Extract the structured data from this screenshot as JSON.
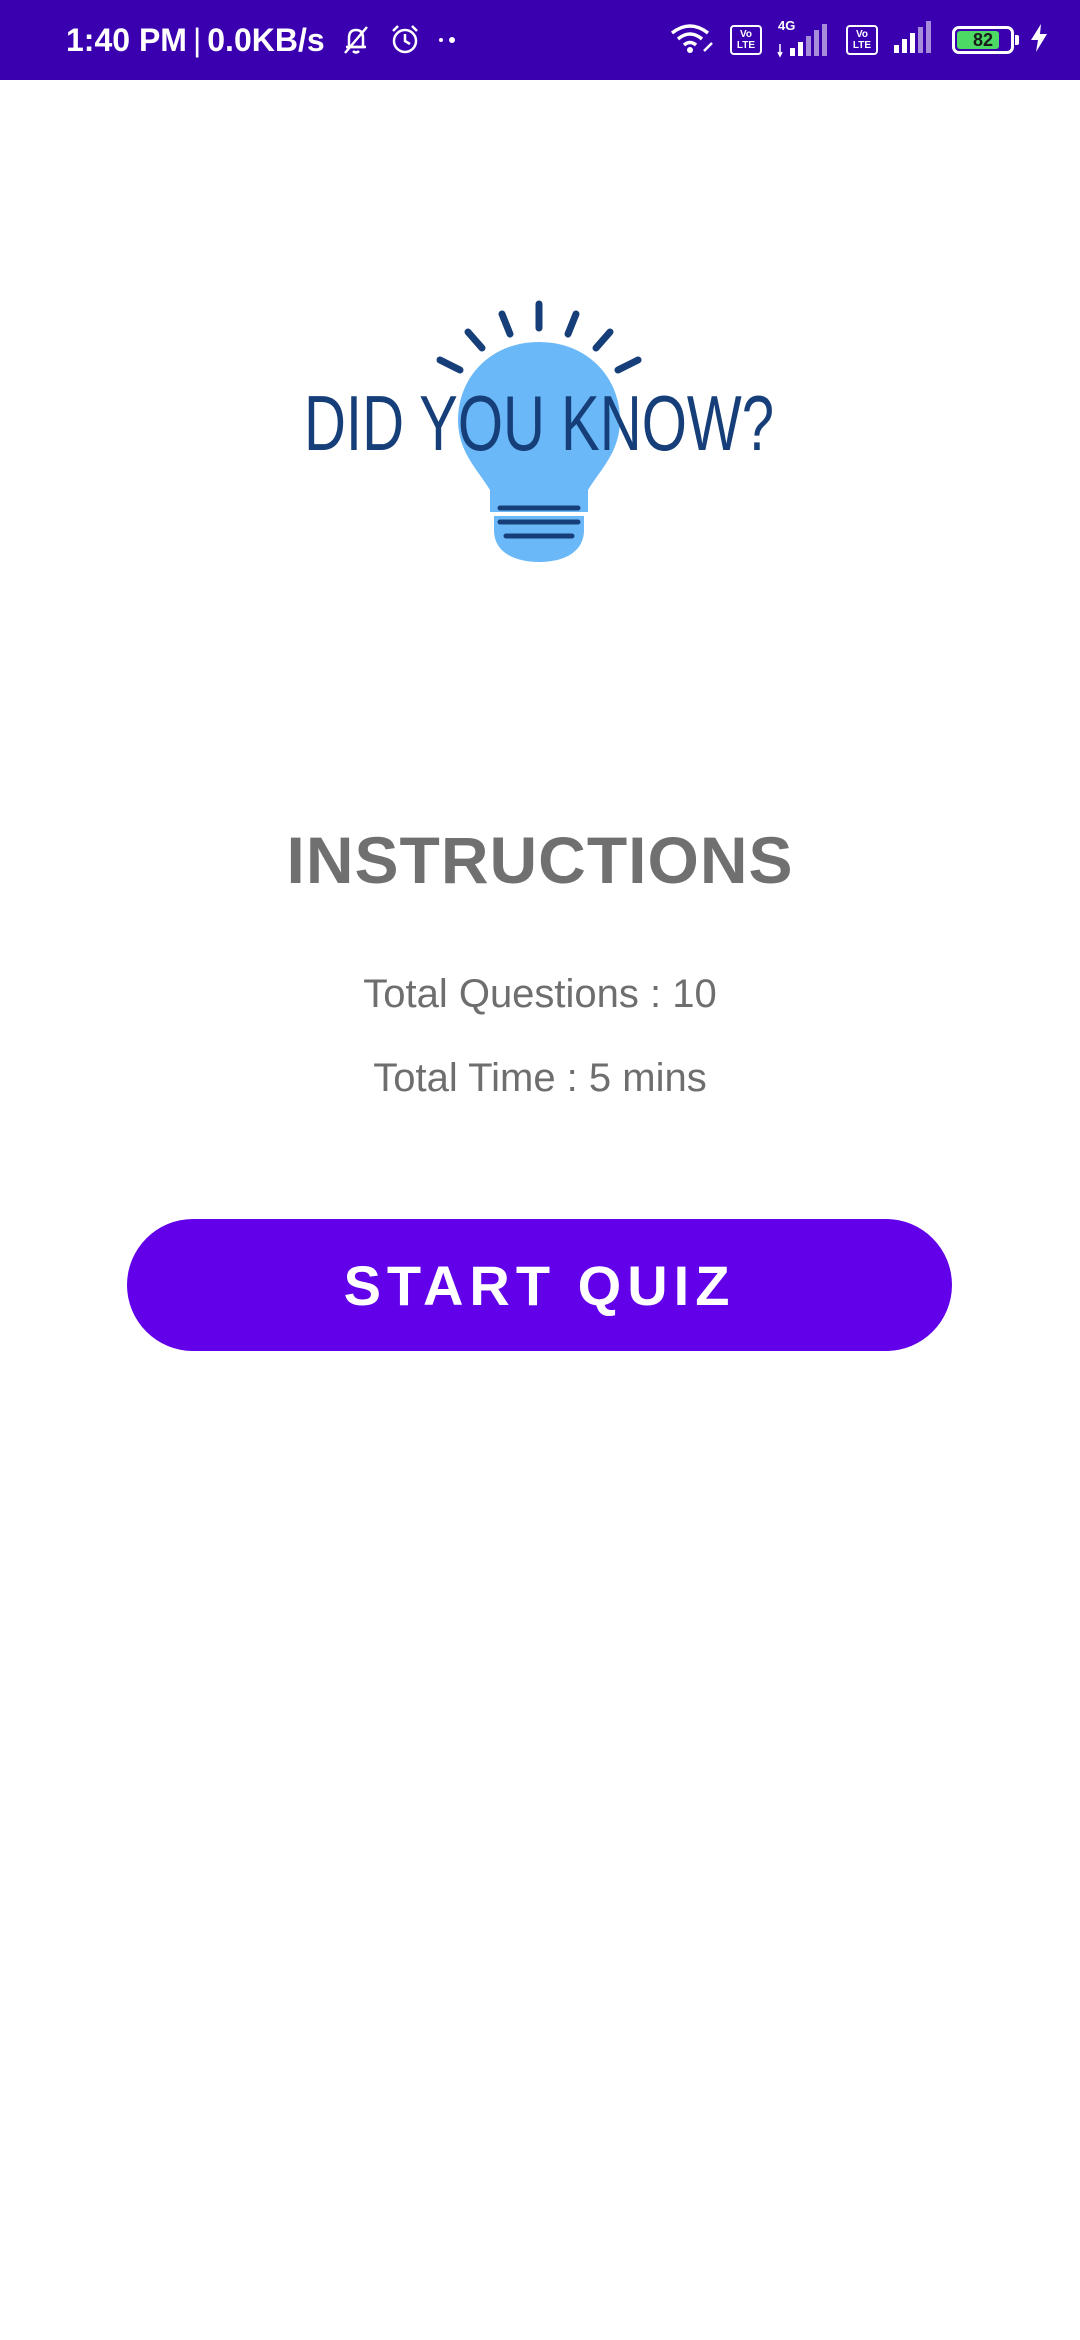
{
  "status_bar": {
    "time": "1:40 PM",
    "separator": "|",
    "speed": "0.0KB/s",
    "network_type": "4G",
    "volte_top": "Vo",
    "volte_bottom": "LTE",
    "battery_level": "82",
    "battery_fraction": 0.82,
    "background_color": "#3a00b0",
    "icons": [
      "silent-bell-icon",
      "alarm-icon",
      "dots-icon",
      "wifi-icon",
      "volte-icon",
      "signal-icon",
      "battery-icon",
      "charging-icon"
    ]
  },
  "logo": {
    "text": "DID YOU KNOW?",
    "bulb_color": "#6ab8f7",
    "text_color": "#163f7a"
  },
  "instructions": {
    "title": "INSTRUCTIONS",
    "total_questions": "Total Questions : 10",
    "total_time": "Total Time : 5 mins"
  },
  "start_button": {
    "label": "START QUIZ",
    "color": "#6200ea"
  }
}
